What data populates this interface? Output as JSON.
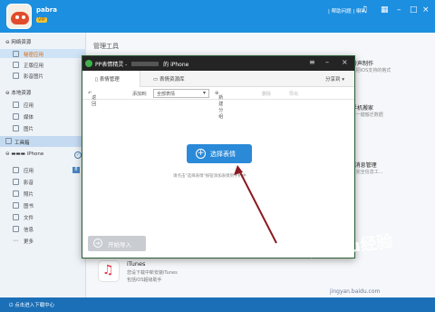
{
  "header": {
    "username": "pabra",
    "vip_badge": "VIP",
    "top_right_text": "| 帮助问题 | 喇叭"
  },
  "sidebar": {
    "sections": [
      {
        "label": "网络资源",
        "items": [
          "秘密应用",
          "正版应用",
          "影音图片"
        ]
      },
      {
        "label": "本地资源",
        "items": [
          "应用",
          "媒体",
          "图片"
        ]
      },
      {
        "label": "工具箱",
        "items": []
      },
      {
        "label": "iPhone",
        "items": [
          "应用",
          "影音",
          "照片",
          "图书",
          "文件",
          "信息",
          "更多"
        ]
      }
    ],
    "app_badge": "8"
  },
  "main": {
    "title": "管理工具",
    "right_items": [
      {
        "title": "铃声制作",
        "sub": "...把iOS支持的格式"
      },
      {
        "title": "手机搬家",
        "sub": "...一键搬迁数据"
      },
      {
        "title": "P消息管理",
        "sub": "...完全信息工..."
      }
    ],
    "itunes_title": "iTunes",
    "itunes_sub1": "您设下载中新安装iTunes",
    "itunes_sub2": "包括iOS超级助手"
  },
  "dialog": {
    "title": "PP表情精灵 -",
    "device_suffix": "的 iPhone",
    "tabs": [
      "表情管理",
      "表情资源库"
    ],
    "share_label": "分享到",
    "toolbar": {
      "back": "返回",
      "add_to": "添加到:",
      "select_value": "全部表情",
      "new_group": "新建分组",
      "delete": "删除",
      "export": "导出"
    },
    "select_button": "选择表情",
    "hint": "请点击\"选择表情\"按钮添加表情到手机中",
    "import_button": "开始导入"
  },
  "bottombar": {
    "download_center": "点击进入下载中心"
  },
  "watermark": {
    "text": "Baidu经验",
    "url": "jingyan.baidu.com"
  }
}
